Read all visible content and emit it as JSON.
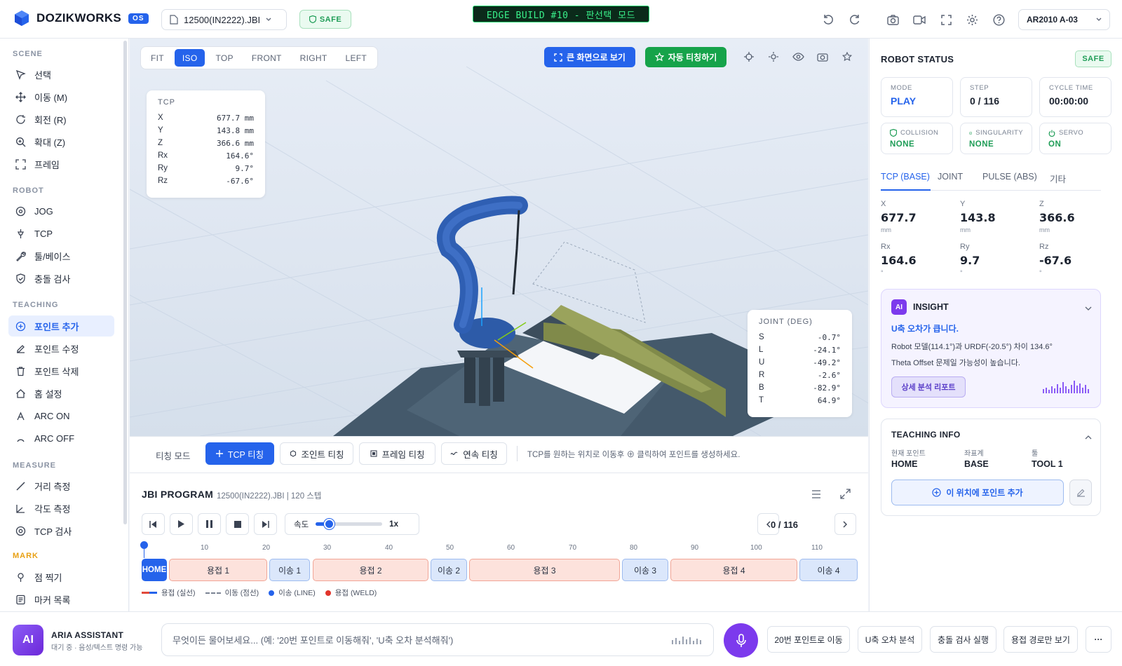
{
  "header": {
    "brand": "DOZIKWORKS",
    "os_badge": "OS",
    "file_name": "12500(IN2222).JBI",
    "safe_label": "SAFE",
    "edge_banner": "EDGE BUILD #10 - 판선택 모드",
    "robot_model": "AR2010 A-03"
  },
  "sidebar": {
    "sections": {
      "scene": "SCENE",
      "robot": "ROBOT",
      "teaching": "TEACHING",
      "measure": "MEASURE",
      "mark": "MARK"
    },
    "scene": [
      "선택",
      "이동 (M)",
      "회전 (R)",
      "확대 (Z)",
      "프레임"
    ],
    "robot": [
      "JOG",
      "TCP",
      "툴/베이스",
      "충돌 검사"
    ],
    "teaching": [
      "포인트 추가",
      "포인트 수정",
      "포인트 삭제",
      "홈 설정",
      "ARC ON",
      "ARC OFF"
    ],
    "measure": [
      "거리 측정",
      "각도 측정",
      "TCP 검사"
    ],
    "mark": [
      "점 찍기",
      "마커 목록"
    ]
  },
  "viewport": {
    "views": [
      "FIT",
      "ISO",
      "TOP",
      "FRONT",
      "RIGHT",
      "LEFT"
    ],
    "active_view": "ISO",
    "fullscreen_label": "큰 화면으로 보기",
    "auto_teach_label": "자동 티칭하기",
    "tcp": {
      "title": "TCP",
      "rows": [
        [
          "X",
          "677.7 mm"
        ],
        [
          "Y",
          "143.8 mm"
        ],
        [
          "Z",
          "366.6 mm"
        ],
        [
          "Rx",
          "164.6°"
        ],
        [
          "Ry",
          "9.7°"
        ],
        [
          "Rz",
          "-67.6°"
        ]
      ]
    },
    "joint": {
      "title": "JOINT (DEG)",
      "rows": [
        [
          "S",
          "-0.7°"
        ],
        [
          "L",
          "-24.1°"
        ],
        [
          "U",
          "-49.2°"
        ],
        [
          "R",
          "-2.6°"
        ],
        [
          "B",
          "-82.9°"
        ],
        [
          "T",
          "64.9°"
        ]
      ]
    }
  },
  "teachbar": {
    "label": "티칭 모드",
    "buttons": [
      "TCP 티칭",
      "조인트 티칭",
      "프레임 티칭",
      "연속 티칭"
    ],
    "hint": "TCP를 원하는 위치로 이동후 ⊕ 클릭하여 포인트를 생성하세요."
  },
  "program": {
    "title": "JBI PROGRAM",
    "subtitle": "12500(IN2222).JBI | 120 스텝",
    "speed_label": "속도",
    "speed_value": "1x",
    "speed_fraction": 0.2,
    "counter": "0 / 116",
    "ticks": [
      "10",
      "20",
      "30",
      "40",
      "50",
      "60",
      "70",
      "80",
      "90",
      "100",
      "110"
    ],
    "segments": [
      "HOME",
      "용접 1",
      "이송 1",
      "용접 2",
      "이송 2",
      "용접 3",
      "이송 3",
      "용접 4",
      "이송 4"
    ],
    "legend": [
      "용접 (실선)",
      "이동 (점선)",
      "이송 (LINE)",
      "용접 (WELD)"
    ]
  },
  "status": {
    "title": "ROBOT STATUS",
    "safe": "SAFE",
    "mode_label": "MODE",
    "mode_value": "PLAY",
    "step_label": "STEP",
    "step_value": "0 / 116",
    "cycle_label": "CYCLE TIME",
    "cycle_value": "00:00:00",
    "collision_label": "COLLISION",
    "collision_value": "NONE",
    "singularity_label": "SINGULARITY",
    "singularity_value": "NONE",
    "servo_label": "SERVO",
    "servo_value": "ON",
    "tabs": [
      "TCP (BASE)",
      "JOINT",
      "PULSE (ABS)",
      "기타"
    ],
    "coords": [
      [
        "X",
        "677.7",
        "mm"
      ],
      [
        "Y",
        "143.8",
        "mm"
      ],
      [
        "Z",
        "366.6",
        "mm"
      ],
      [
        "Rx",
        "164.6",
        "°"
      ],
      [
        "Ry",
        "9.7",
        "°"
      ],
      [
        "Rz",
        "-67.6",
        "°"
      ]
    ]
  },
  "insight": {
    "badge": "AI",
    "title": "INSIGHT",
    "headline": "U축 오차가 큽니다.",
    "line1": "Robot 모델(114.1°)과 URDF(-20.5°) 차이 134.6°",
    "line2": "Theta Offset 문제일 가능성이 높습니다.",
    "report_btn": "상세 분석 리포트"
  },
  "teachinfo": {
    "title": "TEACHING INFO",
    "current_label": "현재 포인트",
    "current_value": "HOME",
    "coord_label": "좌표계",
    "coord_value": "BASE",
    "tool_label": "툴",
    "tool_value": "TOOL 1",
    "add_btn": "이 위치에 포인트 추가"
  },
  "assistant": {
    "avatar": "AI",
    "name": "ARIA ASSISTANT",
    "status": "대기 중 · 음성/텍스트 명령 가능",
    "placeholder": "무엇이든 물어보세요... (예: '20번 포인트로 이동해줘', 'U축 오차 분석해줘')",
    "quick": [
      "20번 포인트로 이동",
      "U축 오차 분석",
      "충돌 검사 실행",
      "용접 경로만 보기"
    ],
    "more": "···"
  }
}
